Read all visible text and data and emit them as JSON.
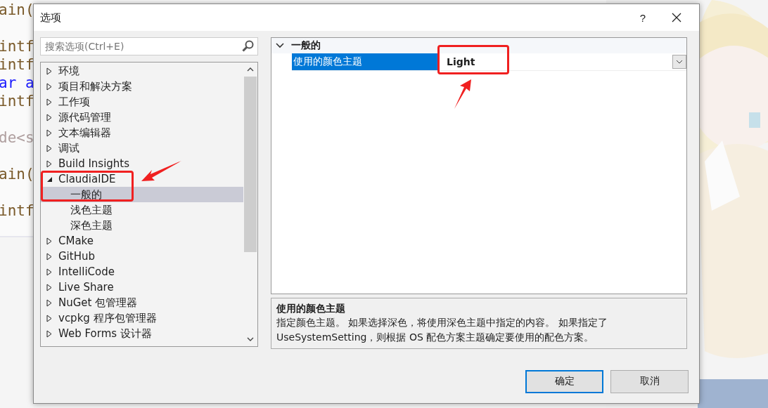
{
  "editor_lines": [
    {
      "text": "ain(",
      "kind": "code"
    },
    {
      "kind": "blank"
    },
    {
      "text": "intf",
      "kind": "code"
    },
    {
      "text": "intf",
      "kind": "code"
    },
    {
      "text": "ar a",
      "kind": "keyword"
    },
    {
      "text": "intf",
      "kind": "code"
    },
    {
      "kind": "blank"
    },
    {
      "text": "de<s",
      "kind": "directive"
    },
    {
      "kind": "blank"
    },
    {
      "text": "ain(",
      "kind": "code"
    },
    {
      "kind": "blank"
    },
    {
      "text": "intf",
      "kind": "code"
    }
  ],
  "dialog": {
    "title": "选项",
    "help": "?",
    "search": {
      "placeholder": "搜索选项(Ctrl+E)"
    },
    "tree": [
      {
        "label": "环境",
        "expanded": false,
        "selected": false
      },
      {
        "label": "项目和解决方案",
        "expanded": false,
        "selected": false
      },
      {
        "label": "工作项",
        "expanded": false,
        "selected": false
      },
      {
        "label": "源代码管理",
        "expanded": false,
        "selected": false
      },
      {
        "label": "文本编辑器",
        "expanded": false,
        "selected": false
      },
      {
        "label": "调试",
        "expanded": false,
        "selected": false
      },
      {
        "label": "Build Insights",
        "expanded": false,
        "selected": false
      },
      {
        "label": "ClaudialDE",
        "expanded": true,
        "selected": false,
        "highlighted": true,
        "children": [
          {
            "label": "一般的",
            "selected": true
          },
          {
            "label": "浅色主题",
            "selected": false
          },
          {
            "label": "深色主题",
            "selected": false
          }
        ]
      },
      {
        "label": "CMake",
        "expanded": false,
        "selected": false
      },
      {
        "label": "GitHub",
        "expanded": false,
        "selected": false
      },
      {
        "label": "IntelliCode",
        "expanded": false,
        "selected": false
      },
      {
        "label": "Live Share",
        "expanded": false,
        "selected": false
      },
      {
        "label": "NuGet 包管理器",
        "expanded": false,
        "selected": false
      },
      {
        "label": "vcpkg 程序包管理器",
        "expanded": false,
        "selected": false
      },
      {
        "label": "Web Forms 设计器",
        "expanded": false,
        "selected": false
      }
    ],
    "properties": {
      "category": "一般的",
      "expanded": true,
      "rows": [
        {
          "name": "使用的颜色主题",
          "value": "Light",
          "selected": true,
          "highlighted": true
        }
      ]
    },
    "description": {
      "title": "使用的颜色主题",
      "text": "指定颜色主题。 如果选择深色，将使用深色主题中指定的内容。 如果指定了 UseSystemSetting，则根据 OS 配色方案主题确定要使用的配色方案。"
    },
    "buttons": [
      {
        "label": "确定",
        "default": true
      },
      {
        "label": "取消",
        "default": false
      }
    ]
  }
}
